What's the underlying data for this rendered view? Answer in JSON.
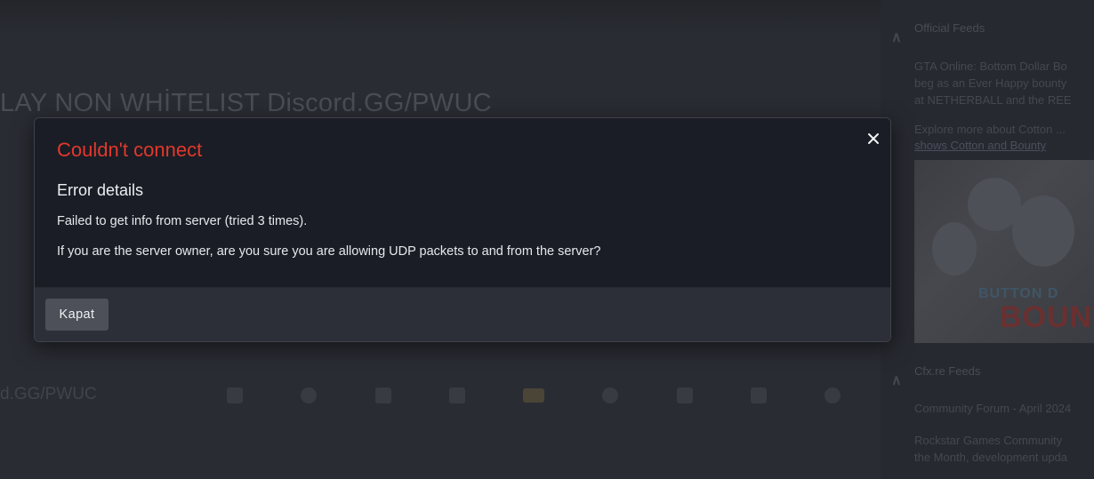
{
  "background": {
    "server_title": "LAY NON WHİTELIST Discord.GG/PWUC",
    "server_link": "d.GG/PWUC",
    "news": [
      {
        "author": "Official Feeds",
        "meta": "",
        "lines": [
          "GTA Online: Bottom Dollar Bo",
          "beg as an Ever Happy bounty",
          "at NETHERBALL and the REE"
        ],
        "link": "Explore more about Cotton ...",
        "link2": "shows Cotton and Bounty"
      },
      {
        "author": "Cfx.re Feeds",
        "meta": "",
        "lines": [
          "Community Forum - April 2024",
          "",
          "Rockstar Games Community",
          "the Month, development upda"
        ]
      }
    ],
    "promo_image": {
      "top_text": "BUTTON D",
      "main_text": "BOUNT"
    }
  },
  "modal": {
    "title": "Couldn't connect",
    "section_title": "Error details",
    "message_line1": "Failed to get info from server (tried 3 times).",
    "message_line2": "If you are the server owner, are you sure you are allowing UDP packets to and from the server?",
    "close_icon": "close-icon",
    "dismiss_label": "Kapat"
  },
  "colors": {
    "error_title": "#e2382c",
    "modal_bg": "#1a1d25",
    "modal_footer_bg": "#2c2f37",
    "button_bg": "#4d5058"
  }
}
